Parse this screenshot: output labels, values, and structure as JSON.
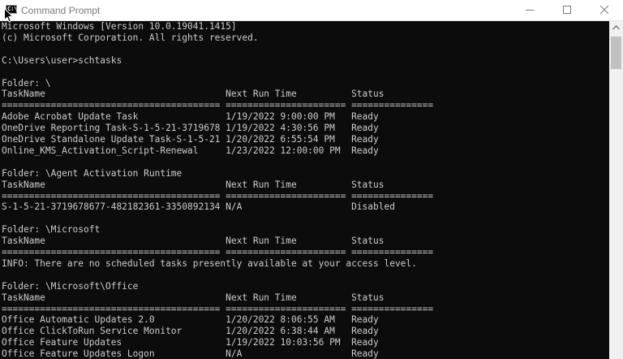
{
  "window": {
    "title": "Command Prompt",
    "icon_label": "C:\\"
  },
  "console": {
    "lines": [
      "Microsoft Windows [Version 10.0.19041.1415]",
      "(c) Microsoft Corporation. All rights reserved.",
      "",
      "C:\\Users\\user>schtasks",
      "",
      "Folder: \\",
      "TaskName                                 Next Run Time          Status",
      "======================================== ====================== ===============",
      "Adobe Acrobat Update Task                1/19/2022 9:00:00 PM   Ready",
      "OneDrive Reporting Task-S-1-5-21-3719678 1/19/2022 4:30:56 PM   Ready",
      "OneDrive Standalone Update Task-S-1-5-21 1/20/2022 6:55:54 PM   Ready",
      "Online_KMS_Activation_Script-Renewal     1/23/2022 12:00:00 PM  Ready",
      "",
      "Folder: \\Agent Activation Runtime",
      "TaskName                                 Next Run Time          Status",
      "======================================== ====================== ===============",
      "S-1-5-21-3719678677-482182361-3350892134 N/A                    Disabled",
      "",
      "Folder: \\Microsoft",
      "TaskName                                 Next Run Time          Status",
      "======================================== ====================== ===============",
      "INFO: There are no scheduled tasks presently available at your access level.",
      "",
      "Folder: \\Microsoft\\Office",
      "TaskName                                 Next Run Time          Status",
      "======================================== ====================== ===============",
      "Office Automatic Updates 2.0             1/20/2022 8:06:55 AM   Ready",
      "Office ClickToRun Service Monitor        1/20/2022 6:38:44 AM   Ready",
      "Office Feature Updates                   1/19/2022 10:03:56 PM  Ready",
      "Office Feature Updates Logon             N/A                    Ready"
    ]
  }
}
